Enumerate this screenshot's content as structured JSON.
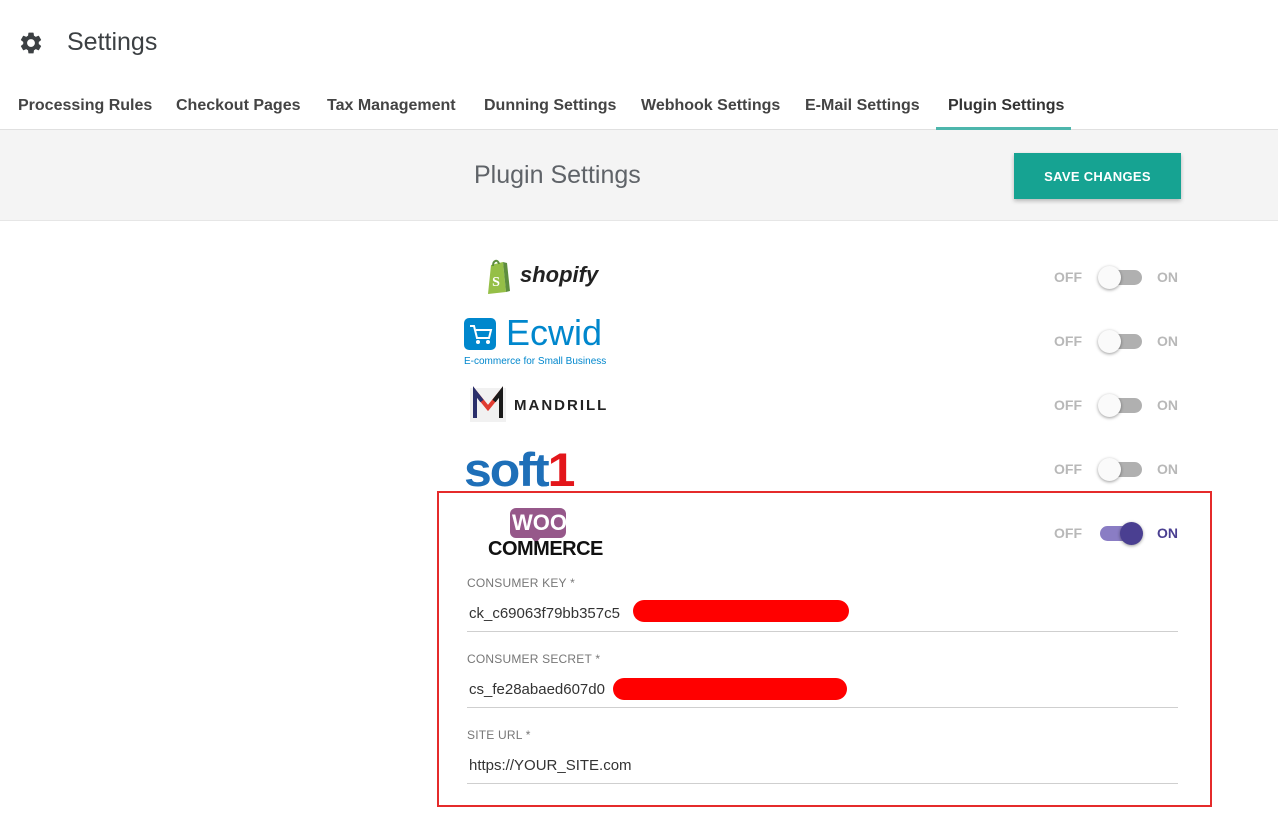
{
  "header": {
    "title": "Settings",
    "icon": "gear-icon"
  },
  "tabs": [
    {
      "label": "Processing Rules",
      "active": false
    },
    {
      "label": "Checkout Pages",
      "active": false
    },
    {
      "label": "Tax Management",
      "active": false
    },
    {
      "label": "Dunning Settings",
      "active": false
    },
    {
      "label": "Webhook Settings",
      "active": false
    },
    {
      "label": "E-Mail Settings",
      "active": false
    },
    {
      "label": "Plugin Settings",
      "active": true
    }
  ],
  "bar": {
    "title": "Plugin Settings",
    "save_label": "SAVE CHANGES"
  },
  "toggle_labels": {
    "off": "OFF",
    "on": "ON"
  },
  "plugins": [
    {
      "name": "shopify",
      "logo_text": "shopify",
      "enabled": false
    },
    {
      "name": "ecwid",
      "logo_text": "Ecwid",
      "logo_subtext": "E-commerce for Small Business",
      "enabled": false
    },
    {
      "name": "mandrill",
      "logo_text": "MANDRILL",
      "enabled": false
    },
    {
      "name": "soft1",
      "logo_text": "soft1",
      "enabled": false
    },
    {
      "name": "woocommerce",
      "logo_text": "WOO",
      "logo_subtext": "COMMERCE",
      "enabled": true
    }
  ],
  "woocommerce_fields": [
    {
      "label": "CONSUMER KEY *",
      "value": "ck_c69063f79bb357c5",
      "redacted": true
    },
    {
      "label": "CONSUMER SECRET *",
      "value": "cs_fe28abaed607d0",
      "redacted": true
    },
    {
      "label": "SITE URL *",
      "value": "https://YOUR_SITE.com",
      "redacted": false
    }
  ],
  "colors": {
    "accent": "#16a392",
    "tab_indicator": "#4db6ac",
    "toggle_on": "#4a3f91",
    "highlight_border": "#e52b2b",
    "redaction": "#ff0000"
  }
}
